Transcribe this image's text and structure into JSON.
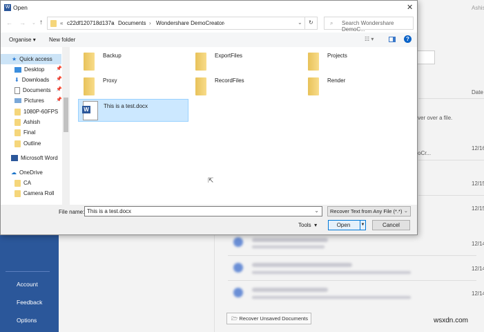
{
  "background": {
    "nav": [
      "Account",
      "Feedback",
      "Options"
    ],
    "user": "Ashis",
    "date_header": "Date",
    "hint": "ver over a file.",
    "path_fragment": "oCr...",
    "dates": [
      "12/16",
      "12/15",
      "12/15",
      "12/14",
      "12/14",
      "12/14"
    ],
    "recover_button": "Recover Unsaved Documents",
    "watermark": "wsxdn.com"
  },
  "dialog": {
    "title": "Open",
    "breadcrumb": [
      "c22df120718d137a",
      "Documents",
      "Wondershare DemoCreator"
    ],
    "search_placeholder": "Search Wondershare DemoC...",
    "toolbar": {
      "organise": "Organise",
      "new_folder": "New folder"
    },
    "sidebar": [
      {
        "label": "Quick access",
        "icon": "star-icon",
        "selected": true
      },
      {
        "label": "Desktop",
        "icon": "desktop-icon",
        "pinned": true
      },
      {
        "label": "Downloads",
        "icon": "download-icon",
        "pinned": true
      },
      {
        "label": "Documents",
        "icon": "documents-icon",
        "pinned": true
      },
      {
        "label": "Pictures",
        "icon": "pictures-icon",
        "pinned": true
      },
      {
        "label": "1080P-60FPS",
        "icon": "folder-icon"
      },
      {
        "label": "Ashish",
        "icon": "folder-icon"
      },
      {
        "label": "Final",
        "icon": "folder-icon"
      },
      {
        "label": "Outline",
        "icon": "folder-icon"
      },
      {
        "label": "Microsoft Word",
        "icon": "word-icon"
      },
      {
        "label": "OneDrive",
        "icon": "cloud-icon"
      },
      {
        "label": "CA",
        "icon": "folder-icon"
      },
      {
        "label": "Camera Roll",
        "icon": "folder-icon"
      }
    ],
    "items": [
      "Backup",
      "ExportFiles",
      "Projects",
      "Proxy",
      "RecordFiles",
      "Render",
      "This is a test.docx"
    ],
    "file_name_label": "File name:",
    "file_name_value": "This is a test.docx",
    "file_type": "Recover Text from Any File (*.*)",
    "tools": "Tools",
    "open": "Open",
    "cancel": "Cancel"
  }
}
